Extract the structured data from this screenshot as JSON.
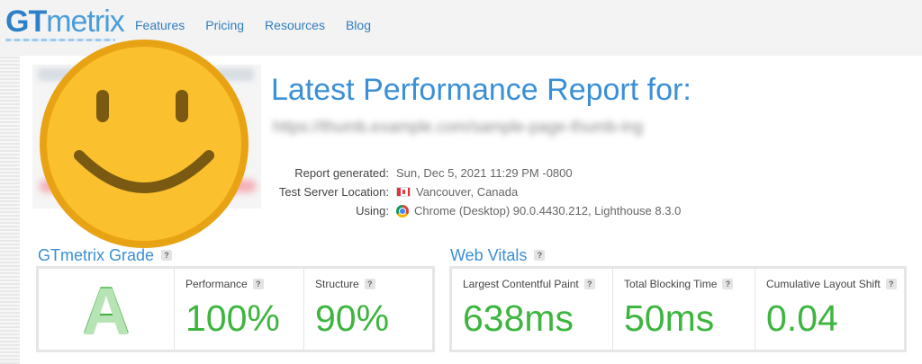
{
  "nav": {
    "logo_gt": "GT",
    "logo_rest": "metrix",
    "links": [
      "Features",
      "Pricing",
      "Resources",
      "Blog"
    ]
  },
  "report": {
    "title": "Latest Performance Report for:",
    "url": "https://thumb.example.com/sample-page-thumb-ing",
    "meta": [
      {
        "label": "Report generated:",
        "value": "Sun, Dec 5, 2021 11:29 PM -0800",
        "icon": ""
      },
      {
        "label": "Test Server Location:",
        "value": "Vancouver, Canada",
        "icon": "canada-flag-icon"
      },
      {
        "label": "Using:",
        "value": "Chrome (Desktop) 90.0.4430.212, Lighthouse 8.3.0",
        "icon": "chrome-icon"
      }
    ]
  },
  "grade": {
    "heading": "GTmetrix Grade",
    "letter": "A",
    "performance_label": "Performance",
    "performance_value": "100%",
    "structure_label": "Structure",
    "structure_value": "90%"
  },
  "vitals": {
    "heading": "Web Vitals",
    "lcp_label": "Largest Contentful Paint",
    "lcp_value": "638ms",
    "tbt_label": "Total Blocking Time",
    "tbt_value": "50ms",
    "cls_label": "Cumulative Layout Shift",
    "cls_value": "0.04"
  },
  "help_glyph": "?",
  "colors": {
    "brand_blue": "#3a8fd6",
    "good_green": "#3db53f",
    "smiley_yellow": "#fbc02d"
  }
}
